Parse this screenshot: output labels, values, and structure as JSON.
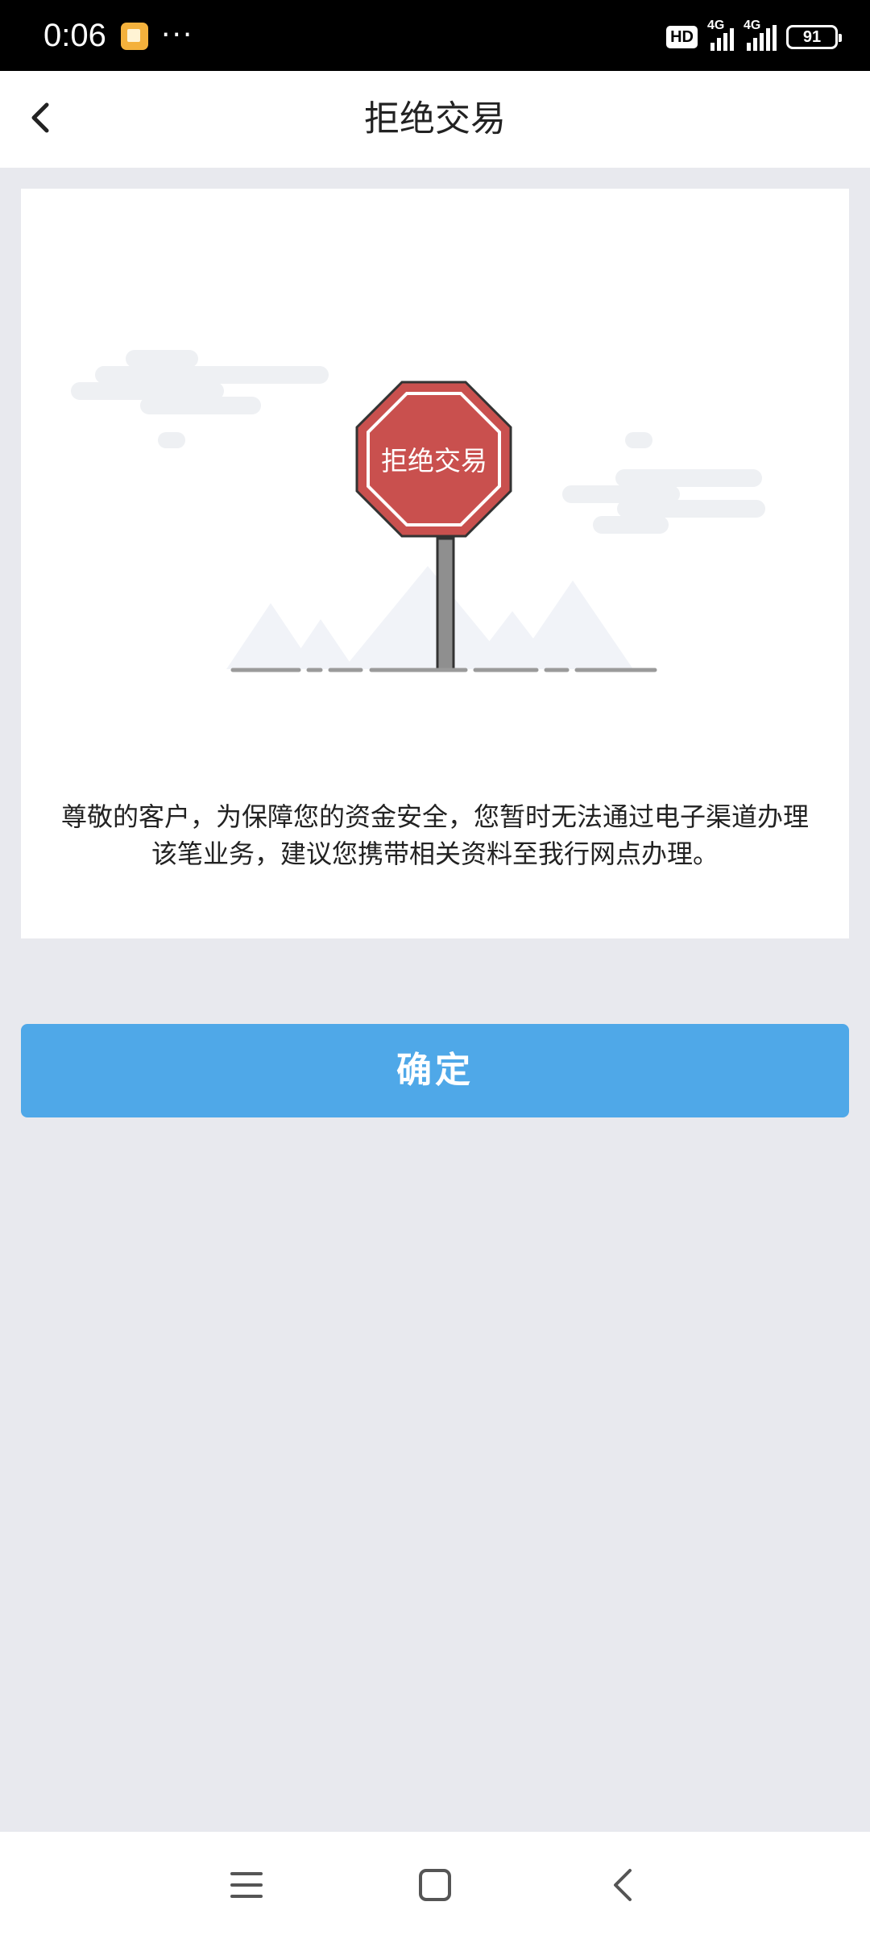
{
  "status_bar": {
    "time": "0:06",
    "more": "···",
    "hd_badge": "HD",
    "sim1_gen": "4G",
    "sim2_gen": "4G",
    "battery": "91",
    "icons": [
      "app-notification-icon",
      "hd-icon",
      "signal-icon",
      "signal-icon",
      "battery-icon"
    ]
  },
  "header": {
    "title": "拒绝交易",
    "back_icon": "chevron-left-icon"
  },
  "illustration": {
    "sign_text": "拒绝交易",
    "sign_color": "#c9504e"
  },
  "message": "尊敬的客户，为保障您的资金安全，您暂时无法通过电子渠道办理该笔业务，建议您携带相关资料至我行网点办理。",
  "confirm_button": {
    "label": "确定",
    "color": "#4fa8e8"
  },
  "system_nav": {
    "icons": [
      "menu-icon",
      "home-icon",
      "back-icon"
    ]
  }
}
